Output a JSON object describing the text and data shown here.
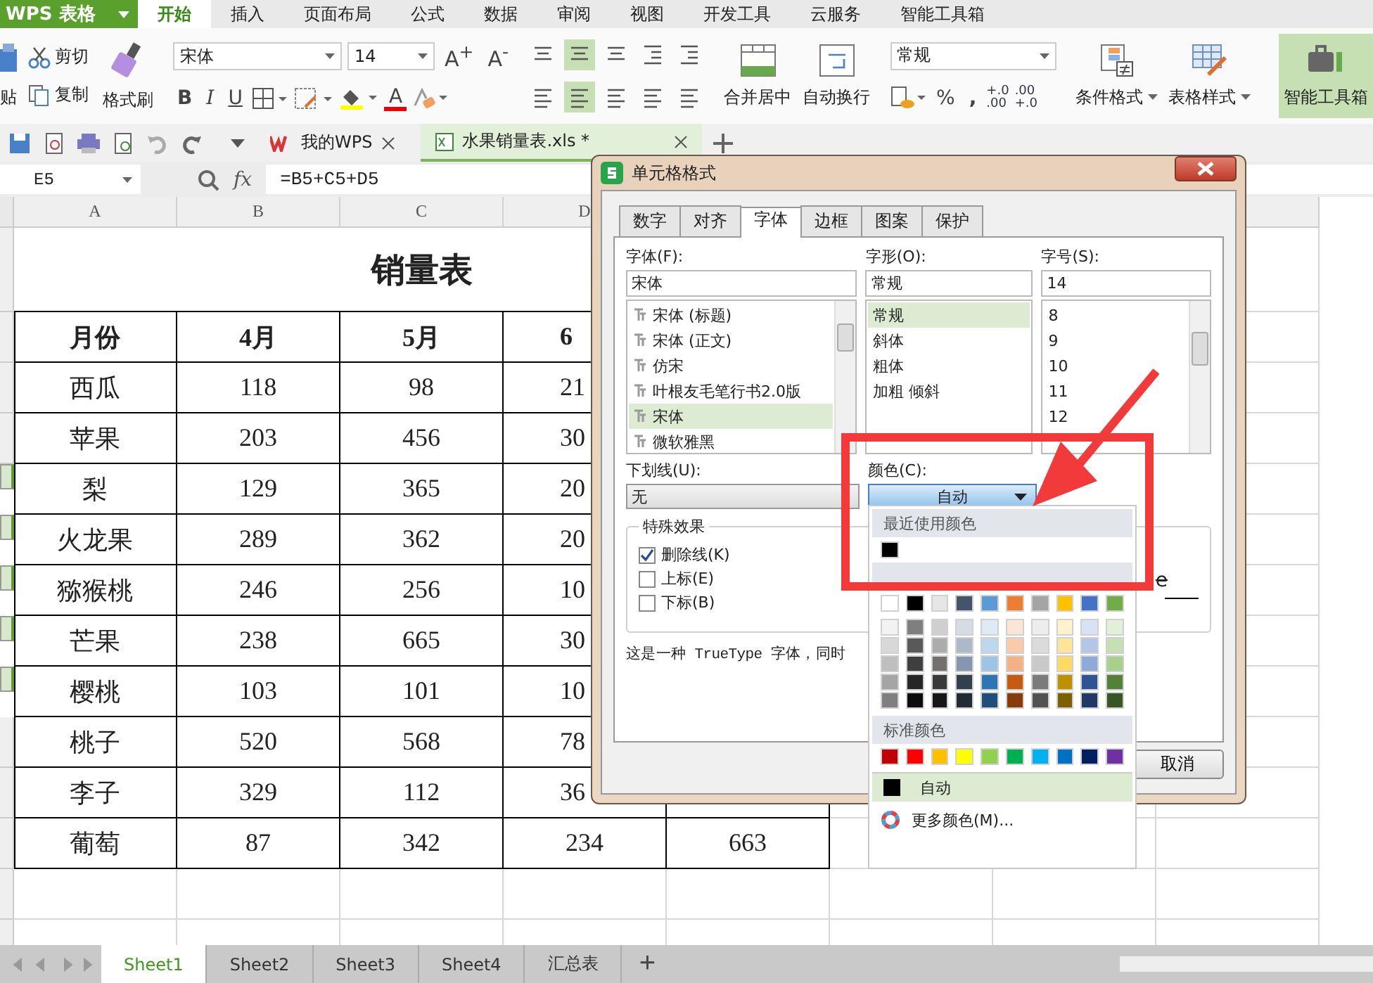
{
  "menu": {
    "app_button": "WPS 表格",
    "tabs": [
      {
        "label": "开始",
        "selected": true
      },
      {
        "label": "插入",
        "selected": false
      },
      {
        "label": "页面布局",
        "selected": false
      },
      {
        "label": "公式",
        "selected": false
      },
      {
        "label": "数据",
        "selected": false
      },
      {
        "label": "审阅",
        "selected": false
      },
      {
        "label": "视图",
        "selected": false
      },
      {
        "label": "开发工具",
        "selected": false
      },
      {
        "label": "云服务",
        "selected": false
      },
      {
        "label": "智能工具箱",
        "selected": false
      }
    ]
  },
  "ribbon": {
    "paste": "贴",
    "cut": "剪切",
    "copy": "复制",
    "format_painter": "格式刷",
    "font_name": "宋体",
    "font_size": "14",
    "grow": "A$^{+}$",
    "shrink": "A$^{-}$",
    "bold": "B",
    "italic": "I",
    "underline": "U",
    "font_color": "A",
    "merge": "合并居中",
    "wrap": "自动换行",
    "number_format": "常规",
    "percent": "%",
    "comma": ",",
    "increase_decimal": {
      "top": "+.0",
      "bottom": ".00"
    },
    "decrease_decimal": {
      "top": ".00",
      "bottom": "+.0"
    },
    "conditional_format": "条件格式",
    "table_style": "表格样式",
    "toolbox": "智能工具箱"
  },
  "doc_tabs": [
    {
      "label": "我的WPS",
      "selected": false
    },
    {
      "label": "水果销量表.xls *",
      "selected": true
    }
  ],
  "formula_bar": {
    "cell": "E5",
    "fx": "fx",
    "formula": "=B5+C5+D5"
  },
  "sheet": {
    "columns": [
      "A",
      "B",
      "C",
      "D"
    ],
    "title": "销量表",
    "header": [
      "月份",
      "4月",
      "5月",
      "6"
    ],
    "rows": [
      {
        "cells": [
          "西瓜",
          "118",
          "98",
          "21"
        ],
        "selected": false
      },
      {
        "cells": [
          "苹果",
          "203",
          "456",
          "30"
        ],
        "selected": false
      },
      {
        "cells": [
          "梨",
          "129",
          "365",
          "20"
        ],
        "selected": true
      },
      {
        "cells": [
          "火龙果",
          "289",
          "362",
          "20"
        ],
        "selected": true
      },
      {
        "cells": [
          "猕猴桃",
          "246",
          "256",
          "10"
        ],
        "selected": true
      },
      {
        "cells": [
          "芒果",
          "238",
          "665",
          "30"
        ],
        "selected": true
      },
      {
        "cells": [
          "樱桃",
          "103",
          "101",
          "10"
        ],
        "selected": true
      },
      {
        "cells": [
          "桃子",
          "520",
          "568",
          "78"
        ],
        "selected": false
      },
      {
        "cells": [
          "李子",
          "329",
          "112",
          "36"
        ],
        "selected": false
      },
      {
        "cells": [
          "葡萄",
          "87",
          "342",
          "234",
          "663"
        ],
        "selected": false
      }
    ]
  },
  "sheet_tabs": [
    {
      "label": "Sheet1",
      "selected": true
    },
    {
      "label": "Sheet2",
      "selected": false
    },
    {
      "label": "Sheet3",
      "selected": false
    },
    {
      "label": "Sheet4",
      "selected": false
    },
    {
      "label": "汇总表",
      "selected": false
    }
  ],
  "add_sheet": "+",
  "dialog": {
    "title": "单元格格式",
    "tabs": [
      {
        "label": "数字",
        "selected": false
      },
      {
        "label": "对齐",
        "selected": false
      },
      {
        "label": "字体",
        "selected": true
      },
      {
        "label": "边框",
        "selected": false
      },
      {
        "label": "图案",
        "selected": false
      },
      {
        "label": "保护",
        "selected": false
      }
    ],
    "font_label": "字体(F):",
    "font_value": "宋体",
    "fonts": [
      {
        "label": "宋体 (标题)",
        "selected": false
      },
      {
        "label": "宋体 (正文)",
        "selected": false
      },
      {
        "label": "仿宋",
        "selected": false
      },
      {
        "label": "叶根友毛笔行书2.0版",
        "selected": false
      },
      {
        "label": "宋体",
        "selected": true
      },
      {
        "label": "微软雅黑",
        "selected": false
      }
    ],
    "style_label": "字形(O):",
    "style_value": "常规",
    "styles": [
      {
        "label": "常规",
        "selected": true
      },
      {
        "label": "斜体",
        "selected": false
      },
      {
        "label": "粗体",
        "selected": false
      },
      {
        "label": "加粗 倾斜",
        "selected": false
      }
    ],
    "size_label": "字号(S):",
    "size_value": "14",
    "sizes": [
      {
        "label": "8",
        "selected": false
      },
      {
        "label": "9",
        "selected": false
      },
      {
        "label": "10",
        "selected": false
      },
      {
        "label": "11",
        "selected": false
      },
      {
        "label": "12",
        "selected": false
      }
    ],
    "underline_label": "下划线(U):",
    "underline_value": "无",
    "color_label": "颜色(C):",
    "color_value": "自动",
    "effects_title": "特殊效果",
    "effects": [
      {
        "label": "删除线(K)",
        "checked": true
      },
      {
        "label": "上标(E)",
        "checked": false
      },
      {
        "label": "下标(B)",
        "checked": false
      }
    ],
    "preview": "e",
    "description": "这是一种 TrueType 字体，同时",
    "cancel": "取消"
  },
  "color_popup": {
    "recent_title": "最近使用颜色",
    "recent": [
      {
        "color": "#000000"
      }
    ],
    "theme_top": [
      {
        "color": "#ffffff"
      },
      {
        "color": "#000000"
      },
      {
        "color": "#e7e6e6"
      },
      {
        "color": "#44546a"
      },
      {
        "color": "#5b9bd5"
      },
      {
        "color": "#ed7d31"
      },
      {
        "color": "#a5a5a5"
      },
      {
        "color": "#ffc000"
      },
      {
        "color": "#4472c4"
      },
      {
        "color": "#70ad47"
      }
    ],
    "theme_shades": [
      {
        "swatches": [
          {
            "color": "#f2f2f2"
          },
          {
            "color": "#7f7f7f"
          },
          {
            "color": "#d0cece"
          },
          {
            "color": "#d6dce4"
          },
          {
            "color": "#deebf6"
          },
          {
            "color": "#fbe5d5"
          },
          {
            "color": "#ededed"
          },
          {
            "color": "#fff2cc"
          },
          {
            "color": "#d9e2f3"
          },
          {
            "color": "#e2efd9"
          }
        ]
      },
      {
        "swatches": [
          {
            "color": "#d8d8d8"
          },
          {
            "color": "#595959"
          },
          {
            "color": "#aeabab"
          },
          {
            "color": "#adb9ca"
          },
          {
            "color": "#bdd7ee"
          },
          {
            "color": "#f7cbac"
          },
          {
            "color": "#dbdbdb"
          },
          {
            "color": "#fee599"
          },
          {
            "color": "#b4c6e7"
          },
          {
            "color": "#c5e0b3"
          }
        ]
      },
      {
        "swatches": [
          {
            "color": "#bfbfbf"
          },
          {
            "color": "#3f3f3f"
          },
          {
            "color": "#757070"
          },
          {
            "color": "#8496b0"
          },
          {
            "color": "#9dc3e6"
          },
          {
            "color": "#f4b183"
          },
          {
            "color": "#c9c9c9"
          },
          {
            "color": "#ffd965"
          },
          {
            "color": "#8eaadb"
          },
          {
            "color": "#a8d08d"
          }
        ]
      },
      {
        "swatches": [
          {
            "color": "#a5a5a5"
          },
          {
            "color": "#262626"
          },
          {
            "color": "#3a3838"
          },
          {
            "color": "#323f4f"
          },
          {
            "color": "#2e75b5"
          },
          {
            "color": "#c55a11"
          },
          {
            "color": "#7b7b7b"
          },
          {
            "color": "#bf9000"
          },
          {
            "color": "#2f5496"
          },
          {
            "color": "#538135"
          }
        ]
      },
      {
        "swatches": [
          {
            "color": "#7f7f7f"
          },
          {
            "color": "#0c0c0c"
          },
          {
            "color": "#171616"
          },
          {
            "color": "#222a35"
          },
          {
            "color": "#1e4e79"
          },
          {
            "color": "#843c0b"
          },
          {
            "color": "#525252"
          },
          {
            "color": "#7f6000"
          },
          {
            "color": "#1f3864"
          },
          {
            "color": "#375623"
          }
        ]
      }
    ],
    "standard_title": "标准颜色",
    "standard": [
      {
        "color": "#c00000"
      },
      {
        "color": "#ff0000"
      },
      {
        "color": "#ffc000"
      },
      {
        "color": "#ffff00"
      },
      {
        "color": "#92d050"
      },
      {
        "color": "#00b050"
      },
      {
        "color": "#00b0f0"
      },
      {
        "color": "#0070c0"
      },
      {
        "color": "#002060"
      },
      {
        "color": "#7030a0"
      }
    ],
    "auto": {
      "label": "自动",
      "selected": true,
      "color": "#000000"
    },
    "more": "更多颜色(M)..."
  }
}
